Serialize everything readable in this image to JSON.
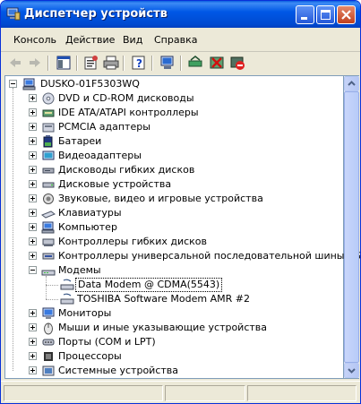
{
  "window": {
    "title": "Диспетчер устройств",
    "title_icon": "device-manager-icon",
    "controls": [
      "minimize-icon",
      "maximize-icon",
      "close-icon"
    ]
  },
  "menu": {
    "items": [
      {
        "label": "Консоль"
      },
      {
        "label": "Действие"
      },
      {
        "label": "Вид"
      },
      {
        "label": "Справка"
      }
    ]
  },
  "toolbar": {
    "buttons": [
      "back-icon",
      "forward-icon",
      "show-hide-tree-icon",
      "properties-icon",
      "print-icon",
      "help-icon",
      "scan-hardware-icon",
      "update-driver-icon",
      "uninstall-icon",
      "disable-icon"
    ]
  },
  "tree": {
    "root": "DUSKO-01F5303WQ",
    "items": [
      {
        "label": "DVD и CD-ROM дисководы",
        "icon": "cdrom-icon",
        "expanded": false
      },
      {
        "label": "IDE ATA/ATAPI контроллеры",
        "icon": "ide-controller-icon",
        "expanded": false
      },
      {
        "label": "PCMCIA адаптеры",
        "icon": "pcmcia-icon",
        "expanded": false
      },
      {
        "label": "Батареи",
        "icon": "battery-icon",
        "expanded": false
      },
      {
        "label": "Видеоадаптеры",
        "icon": "display-adapter-icon",
        "expanded": false
      },
      {
        "label": "Дисководы гибких дисков",
        "icon": "floppy-icon",
        "expanded": false
      },
      {
        "label": "Дисковые устройства",
        "icon": "disk-drive-icon",
        "expanded": false
      },
      {
        "label": "Звуковые, видео и игровые устройства",
        "icon": "sound-icon",
        "expanded": false
      },
      {
        "label": "Клавиатуры",
        "icon": "keyboard-icon",
        "expanded": false
      },
      {
        "label": "Компьютер",
        "icon": "computer-icon",
        "expanded": false
      },
      {
        "label": "Контроллеры гибких дисков",
        "icon": "floppy-controller-icon",
        "expanded": false
      },
      {
        "label": "Контроллеры универсальной последовательной шины USB",
        "icon": "usb-icon",
        "expanded": false
      },
      {
        "label": "Модемы",
        "icon": "modem-icon",
        "expanded": true,
        "children": [
          {
            "label": "Data Modem @ CDMA(5543)",
            "icon": "modem-device-icon",
            "selected": true
          },
          {
            "label": "TOSHIBA Software Modem AMR #2",
            "icon": "modem-device-icon",
            "selected": false
          }
        ]
      },
      {
        "label": "Мониторы",
        "icon": "monitor-icon",
        "expanded": false
      },
      {
        "label": "Мыши и иные указывающие устройства",
        "icon": "mouse-icon",
        "expanded": false
      },
      {
        "label": "Порты (COM и LPT)",
        "icon": "port-icon",
        "expanded": false
      },
      {
        "label": "Процессоры",
        "icon": "processor-icon",
        "expanded": false
      },
      {
        "label": "Системные устройства",
        "icon": "system-device-icon",
        "expanded": false
      }
    ]
  },
  "colors": {
    "titlebar": "#0058e6",
    "chrome": "#ece9d8",
    "tree_border": "#7f9db9"
  }
}
